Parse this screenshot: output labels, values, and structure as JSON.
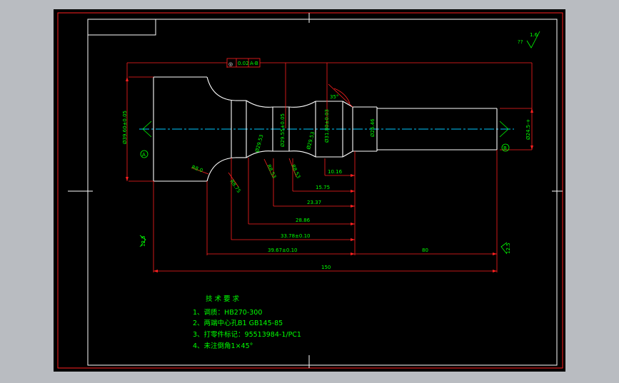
{
  "drawing": {
    "title_block_code": "95513984-1/PC1",
    "tolerance_frame": {
      "symbol": "◎",
      "value": "0.02",
      "datum": "A-B"
    },
    "surface_finish": {
      "default_value": "1.6",
      "default_mark": "??",
      "left_value": "12.5",
      "right_value": "12.5"
    },
    "datum_labels": {
      "left": "A",
      "right": "B"
    },
    "angle_label": "35°",
    "diameters": {
      "left_head": "Ø39.60±0.05",
      "neck1": "Ø29.53",
      "center": "Ø29.55±0.05",
      "neck2": "Ø29.53",
      "collar": "Ø31.80±0.03",
      "pin": "Ø26.46",
      "right_shaft": "Ø24.5-+"
    },
    "radii": {
      "r1": "R8.0",
      "r2": "R8.75",
      "r3": "R8.53",
      "r4": "R8.53"
    },
    "lengths": {
      "l1": "10.16",
      "l2": "15.75",
      "l3": "23.37",
      "l4": "28.86",
      "l5": "33.78±0.10",
      "l6": "39.67±0.10",
      "l7": "80",
      "overall": "150"
    },
    "notes": {
      "heading": "技 术 要 求",
      "items": [
        "1、调质：HB270-300",
        "2、两端中心孔B1 GB145-85",
        "3、打零件标记：95513984-1/PC1",
        "4、未注倒角1×45°"
      ]
    }
  }
}
